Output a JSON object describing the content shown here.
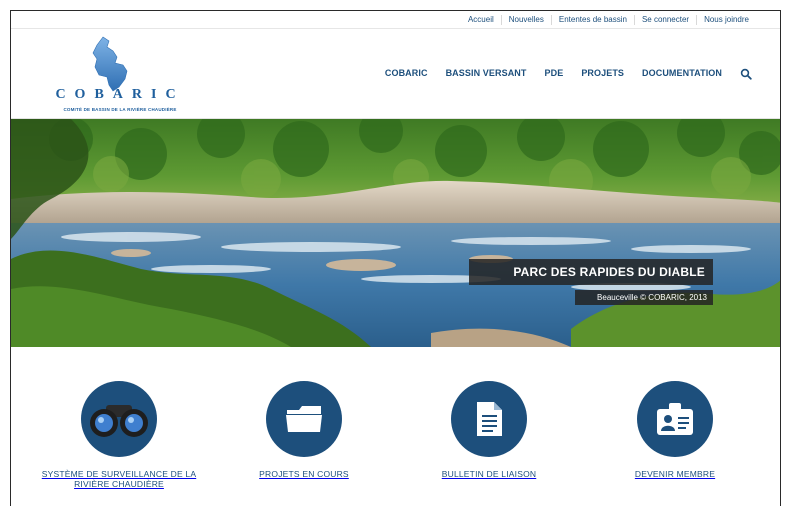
{
  "topbar": {
    "links": [
      "Accueil",
      "Nouvelles",
      "Ententes de bassin",
      "Se connecter",
      "Nous joindre"
    ]
  },
  "logo": {
    "word": "COBARIC",
    "subtitle": "COMITÉ DE BASSIN DE LA RIVIÈRE CHAUDIÈRE"
  },
  "nav": {
    "items": [
      "COBARIC",
      "BASSIN VERSANT",
      "PDE",
      "PROJETS",
      "DOCUMENTATION"
    ],
    "search_icon": "search-icon"
  },
  "hero": {
    "title": "PARC DES RAPIDES DU DIABLE",
    "credit": "Beauceville © COBARIC, 2013"
  },
  "features": [
    {
      "label": "SYSTÈME DE SURVEILLANCE DE LA RIVIÈRE CHAUDIÈRE",
      "icon": "binoculars-icon"
    },
    {
      "label": "PROJETS EN COURS",
      "icon": "folder-icon"
    },
    {
      "label": "BULLETIN DE LIAISON",
      "icon": "document-icon"
    },
    {
      "label": "DEVENIR MEMBRE",
      "icon": "id-badge-icon"
    }
  ],
  "colors": {
    "brand": "#1d4f7c",
    "logo": "#1f5f9d",
    "caption_bg": "#232323"
  }
}
